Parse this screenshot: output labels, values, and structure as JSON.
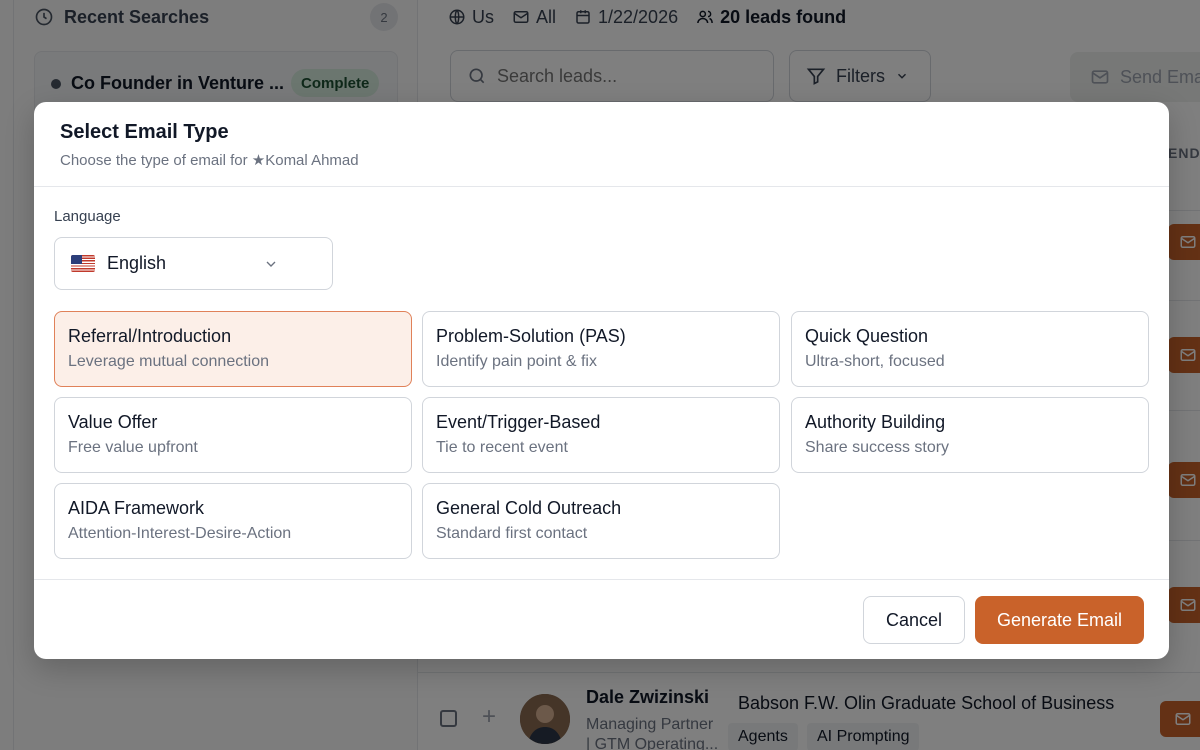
{
  "sidebar": {
    "recent_title": "Recent Searches",
    "recent_count": "2",
    "items": [
      {
        "name": "Co Founder in Venture ...",
        "status": "Complete"
      }
    ]
  },
  "topbar": {
    "location": "Us",
    "email_filter": "All",
    "date": "1/22/2026",
    "leads_found": "20 leads found"
  },
  "toolbar": {
    "search_placeholder": "Search leads...",
    "filters_label": "Filters",
    "send_email_label": "Send Ema"
  },
  "table": {
    "partial_header": "END"
  },
  "lead_row": {
    "name": "Dale Zwizinski",
    "title_line1": "Managing Partner",
    "title_line2": "| GTM Operating...",
    "school": "Babson F.W. Olin Graduate School of Business",
    "tags": [
      "Agents",
      "AI Prompting"
    ]
  },
  "modal": {
    "title": "Select Email Type",
    "subtitle": "Choose the type of email for ★Komal Ahmad",
    "language_label": "Language",
    "language_value": "English",
    "email_types": [
      {
        "title": "Referral/Introduction",
        "desc": "Leverage mutual connection",
        "selected": true
      },
      {
        "title": "Problem-Solution (PAS)",
        "desc": "Identify pain point & fix",
        "selected": false
      },
      {
        "title": "Quick Question",
        "desc": "Ultra-short, focused",
        "selected": false
      },
      {
        "title": "Value Offer",
        "desc": "Free value upfront",
        "selected": false
      },
      {
        "title": "Event/Trigger-Based",
        "desc": "Tie to recent event",
        "selected": false
      },
      {
        "title": "Authority Building",
        "desc": "Share success story",
        "selected": false
      },
      {
        "title": "AIDA Framework",
        "desc": "Attention-Interest-Desire-Action",
        "selected": false
      },
      {
        "title": "General Cold Outreach",
        "desc": "Standard first contact",
        "selected": false
      }
    ],
    "cancel_label": "Cancel",
    "generate_label": "Generate Email"
  },
  "colors": {
    "accent": "#c9622a",
    "selected_bg": "#fcefe8",
    "selected_border": "#e08159"
  }
}
